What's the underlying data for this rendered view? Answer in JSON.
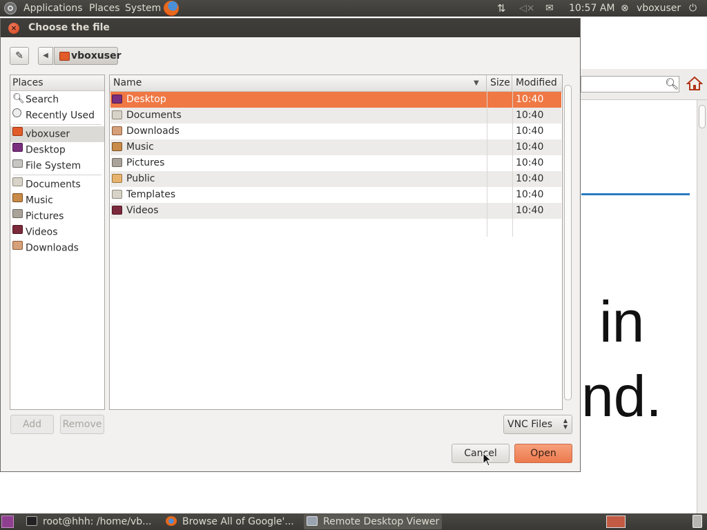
{
  "top_panel": {
    "menus": [
      "Applications",
      "Places",
      "System"
    ],
    "time": "10:57 AM",
    "user": "vboxuser"
  },
  "background_browser": {
    "text_line1": "in",
    "text_line2": "nd."
  },
  "dialog": {
    "title": "Choose the file",
    "path_button": "vboxuser",
    "places_header": "Places",
    "places": [
      {
        "label": "Search",
        "icon": "search-icon"
      },
      {
        "label": "Recently Used",
        "icon": "clock-icon"
      },
      {
        "label": "vboxuser",
        "icon": "home-folder-icon",
        "selected": true
      },
      {
        "label": "Desktop",
        "icon": "desktop-folder-icon"
      },
      {
        "label": "File System",
        "icon": "drive-icon"
      },
      {
        "label": "Documents",
        "icon": "folder-icon"
      },
      {
        "label": "Music",
        "icon": "music-folder-icon"
      },
      {
        "label": "Pictures",
        "icon": "pictures-folder-icon"
      },
      {
        "label": "Videos",
        "icon": "videos-folder-icon"
      },
      {
        "label": "Downloads",
        "icon": "downloads-folder-icon"
      }
    ],
    "columns": {
      "name": "Name",
      "size": "Size",
      "modified": "Modified"
    },
    "files": [
      {
        "name": "Desktop",
        "size": "",
        "modified": "10:40",
        "icon": "desktop-folder-icon",
        "selected": true
      },
      {
        "name": "Documents",
        "size": "",
        "modified": "10:40",
        "icon": "folder-icon"
      },
      {
        "name": "Downloads",
        "size": "",
        "modified": "10:40",
        "icon": "downloads-folder-icon"
      },
      {
        "name": "Music",
        "size": "",
        "modified": "10:40",
        "icon": "music-folder-icon"
      },
      {
        "name": "Pictures",
        "size": "",
        "modified": "10:40",
        "icon": "pictures-folder-icon"
      },
      {
        "name": "Public",
        "size": "",
        "modified": "10:40",
        "icon": "public-folder-icon"
      },
      {
        "name": "Templates",
        "size": "",
        "modified": "10:40",
        "icon": "templates-folder-icon"
      },
      {
        "name": "Videos",
        "size": "",
        "modified": "10:40",
        "icon": "videos-folder-icon"
      }
    ],
    "add_label": "Add",
    "remove_label": "Remove",
    "filter": "VNC Files",
    "cancel_label": "Cancel",
    "open_label": "Open"
  },
  "taskbar": {
    "tasks": [
      {
        "label": "root@hhh: /home/vb..."
      },
      {
        "label": "Browse All of Google'..."
      },
      {
        "label": "Remote Desktop Viewer",
        "active": true
      }
    ]
  },
  "colors": {
    "accent": "#ef7844",
    "panel": "#3c3b37",
    "selection_text": "#ffffff",
    "link_blue": "#2a7ac0"
  }
}
